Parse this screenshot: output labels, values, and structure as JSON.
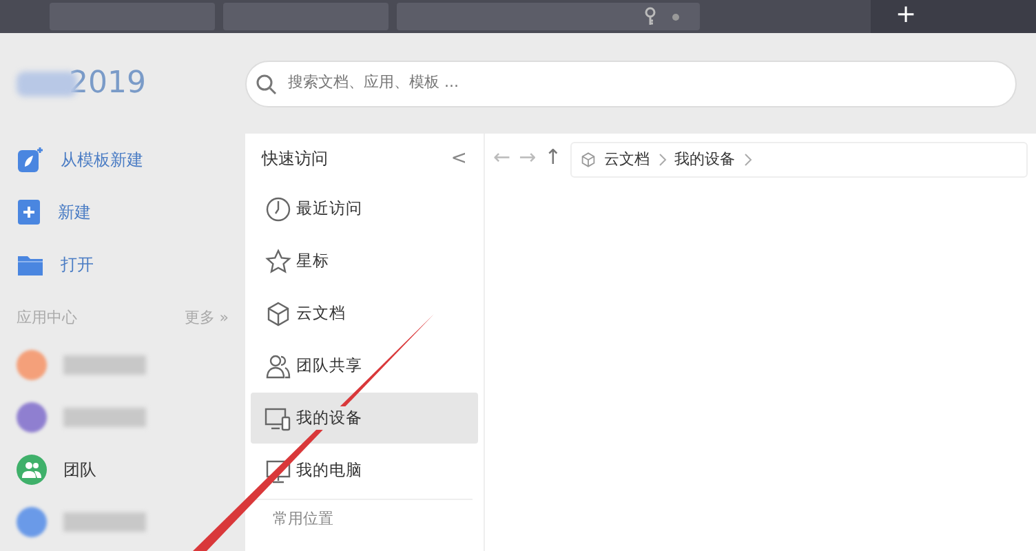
{
  "tab_bar": {
    "new_tab": "+"
  },
  "app": {
    "logo_text": "2019",
    "search": {
      "placeholder": "搜索文档、应用、模板 ..."
    }
  },
  "sidebar": {
    "actions": [
      {
        "kind": "template",
        "label": "从模板新建"
      },
      {
        "kind": "new",
        "label": "新建"
      },
      {
        "kind": "open",
        "label": "打开"
      }
    ],
    "section": {
      "title": "应用中心",
      "more": "更多 »"
    },
    "apps": [
      {
        "kind": "blurred",
        "color": "#f4a07a"
      },
      {
        "kind": "blurred",
        "color": "#8f7fd0"
      },
      {
        "kind": "team",
        "label": "团队",
        "color": "#3fb06a"
      },
      {
        "kind": "blurred",
        "color": "#6a9ae8"
      }
    ]
  },
  "quick_access": {
    "title": "快速访问",
    "collapse": "<",
    "items": [
      {
        "kind": "clock",
        "label": "最近访问",
        "selected": false
      },
      {
        "kind": "star",
        "label": "星标",
        "selected": false
      },
      {
        "kind": "cube",
        "label": "云文档",
        "selected": false
      },
      {
        "kind": "people",
        "label": "团队共享",
        "selected": false
      },
      {
        "kind": "device",
        "label": "我的设备",
        "selected": true
      },
      {
        "kind": "monitor",
        "label": "我的电脑",
        "selected": false
      }
    ],
    "footer": "常用位置"
  },
  "nav": {
    "back": "←",
    "forward": "→",
    "up": "↑"
  },
  "breadcrumb": [
    {
      "label": "云文档"
    },
    {
      "label": "我的设备"
    }
  ]
}
